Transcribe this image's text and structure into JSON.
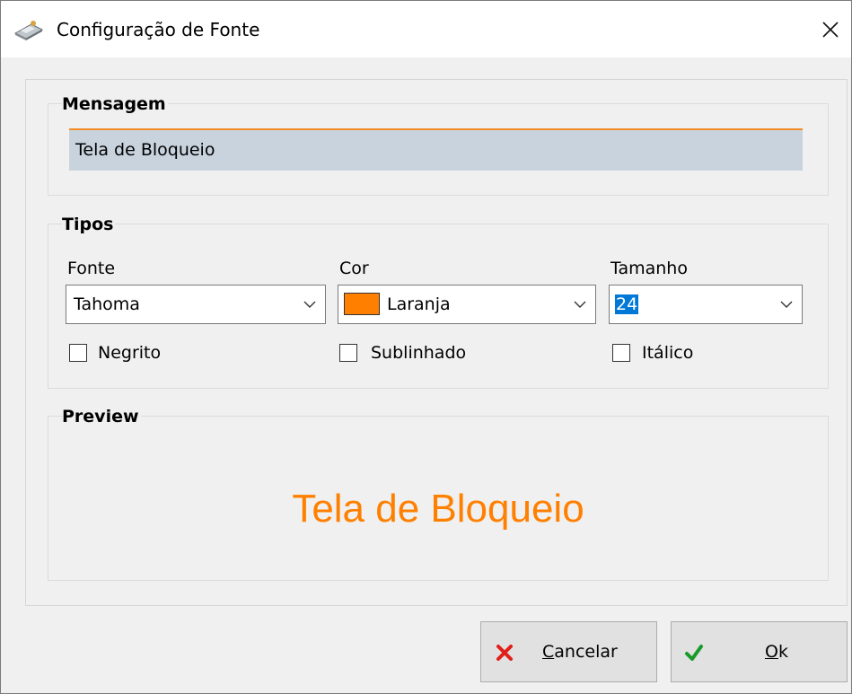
{
  "window": {
    "title": "Configuração de Fonte",
    "icon": "keyboard-icon",
    "close_icon": "close-icon"
  },
  "mensagem": {
    "group_title": "Mensagem",
    "value": "Tela de Bloqueio",
    "accent_color": "#f28c28"
  },
  "tipos": {
    "group_title": "Tipos",
    "fonte": {
      "label": "Fonte",
      "value": "Tahoma"
    },
    "cor": {
      "label": "Cor",
      "value": "Laranja",
      "swatch_color": "#ff8000"
    },
    "tamanho": {
      "label": "Tamanho",
      "value": "24"
    },
    "negrito": {
      "label": "Negrito",
      "checked": false
    },
    "sublinhado": {
      "label": "Sublinhado",
      "checked": false
    },
    "italico": {
      "label": "Itálico",
      "checked": false
    }
  },
  "preview": {
    "group_title": "Preview",
    "text": "Tela de Bloqueio",
    "color": "#ff8000"
  },
  "buttons": {
    "cancel": {
      "mnemonic": "C",
      "rest": "ancelar",
      "icon": "red-x-icon"
    },
    "ok": {
      "mnemonic": "O",
      "rest": "k",
      "icon": "green-check-icon"
    }
  }
}
